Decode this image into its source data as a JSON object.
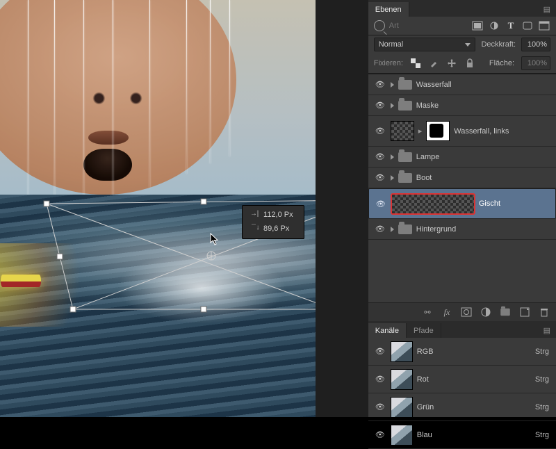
{
  "measure": {
    "w_label": "112,0 Px",
    "h_label": "89,6 Px"
  },
  "panels": {
    "layers": {
      "tab": "Ebenen",
      "filter_placeholder": "Art",
      "blend_mode": "Normal",
      "opacity_label": "Deckkraft:",
      "opacity_value": "100%",
      "lock_label": "Fixieren:",
      "fill_label": "Fläche:",
      "fill_value": "100%",
      "items": [
        {
          "name": "Wasserfall",
          "type": "group"
        },
        {
          "name": "Maske",
          "type": "group"
        },
        {
          "name": "Wasserfall, links",
          "type": "layer_masked"
        },
        {
          "name": "Lampe",
          "type": "group"
        },
        {
          "name": "Boot",
          "type": "group"
        },
        {
          "name": "Gischt",
          "type": "layer_selected"
        },
        {
          "name": "Hintergrund",
          "type": "group"
        }
      ]
    },
    "channels": {
      "tab_active": "Kanäle",
      "tab_inactive": "Pfade",
      "items": [
        {
          "name": "RGB",
          "shortcut": "Strg"
        },
        {
          "name": "Rot",
          "shortcut": "Strg"
        },
        {
          "name": "Grün",
          "shortcut": "Strg"
        },
        {
          "name": "Blau",
          "shortcut": "Strg"
        }
      ]
    }
  }
}
